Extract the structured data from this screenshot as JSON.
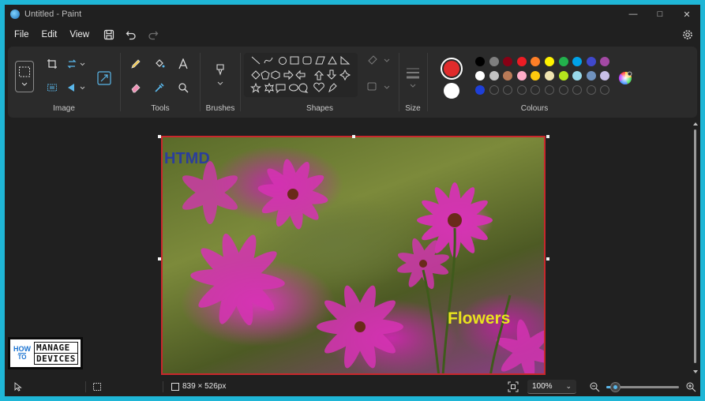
{
  "window": {
    "title": "Untitled - Paint"
  },
  "menu": {
    "file": "File",
    "edit": "Edit",
    "view": "View"
  },
  "ribbon": {
    "image_label": "Image",
    "tools_label": "Tools",
    "brushes_label": "Brushes",
    "shapes_label": "Shapes",
    "size_label": "Size",
    "colours_label": "Colours"
  },
  "colours": {
    "primary": "#e02b2b",
    "secondary": "#ffffff",
    "row1": [
      "#000000",
      "#7f7f7f",
      "#880015",
      "#ed1c24",
      "#ff7f27",
      "#fff200",
      "#22b14c",
      "#00a2e8",
      "#3f48cc",
      "#a349a4"
    ],
    "row2": [
      "#ffffff",
      "#c3c3c3",
      "#b97a57",
      "#ffaec9",
      "#ffc90e",
      "#efe4b0",
      "#b5e61d",
      "#99d9ea",
      "#7092be",
      "#c8bfe7"
    ],
    "row3_first": "#1e3fd8",
    "row3_empty_count": 9
  },
  "canvas": {
    "image_text_1": "HTMD",
    "image_text_2": "Flowers"
  },
  "logo": {
    "how": "HOW",
    "to": "TO",
    "manage": "MANAGE",
    "devices": "DEVICES"
  },
  "status": {
    "canvas_size": "839 × 526px",
    "zoom": "100%",
    "zoom_fraction": 0.12
  }
}
